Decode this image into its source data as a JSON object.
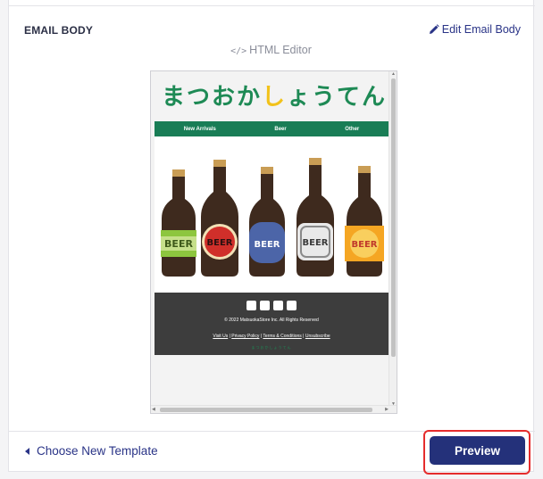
{
  "section": {
    "title": "EMAIL BODY",
    "edit_label": "Edit Email Body",
    "html_editor_label": "HTML Editor",
    "html_editor_glyph": "</>"
  },
  "email": {
    "logo_text_start": "まつおか",
    "logo_text_highlight": "し",
    "logo_text_end": "ょうてん",
    "nav": [
      "New Arrivals",
      "Beer",
      "Other"
    ],
    "bottle_labels": [
      "BEER",
      "BEER",
      "BEER",
      "BEER",
      "BEER"
    ],
    "copyright": "© 2022 MatsuokaStore Inc. All Rights Reserved",
    "footer_links": [
      "Visit Us",
      "Privacy Policy",
      "Terms & Conditions",
      "Unsubscribe"
    ],
    "footer_logo": "まつおかしょうてん"
  },
  "actions": {
    "choose_template": "Choose New Template",
    "preview": "Preview"
  },
  "colors": {
    "accent": "#24317a",
    "link": "#2a3487",
    "highlight_border": "#e52c2c",
    "brand_green": "#197d56",
    "brand_yellow": "#f2c21a"
  }
}
